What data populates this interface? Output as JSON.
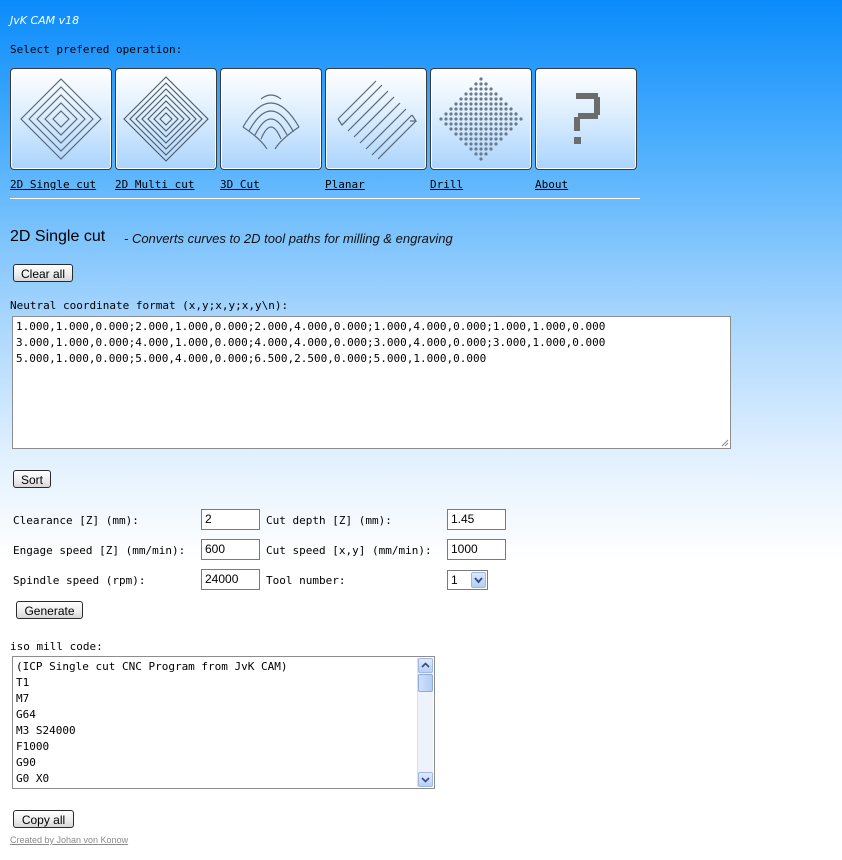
{
  "app": {
    "title": "JvK CAM v18"
  },
  "operation_prompt": "Select prefered operation:",
  "operations": [
    {
      "label": "2D Single cut",
      "icon": "2d-single-cut-icon"
    },
    {
      "label": "2D Multi cut",
      "icon": "2d-multi-cut-icon"
    },
    {
      "label": "3D Cut",
      "icon": "3d-cut-icon"
    },
    {
      "label": "Planar",
      "icon": "planar-icon"
    },
    {
      "label": "Drill",
      "icon": "drill-icon"
    },
    {
      "label": "About",
      "icon": "about-icon"
    }
  ],
  "section": {
    "title": "2D Single cut",
    "subtitle": "- Converts curves to 2D tool paths for milling & engraving"
  },
  "buttons": {
    "clear_all": "Clear all",
    "sort": "Sort",
    "generate": "Generate",
    "copy_all": "Copy all"
  },
  "coords": {
    "label": "Neutral coordinate format (x,y;x,y;x,y\\n):",
    "lines": [
      "1.000,1.000,0.000;2.000,1.000,0.000;2.000,4.000,0.000;1.000,4.000,0.000;1.000,1.000,0.000",
      "3.000,1.000,0.000;4.000,1.000,0.000;4.000,4.000,0.000;3.000,4.000,0.000;3.000,1.000,0.000",
      "5.000,1.000,0.000;5.000,4.000,0.000;6.500,2.500,0.000;5.000,1.000,0.000"
    ]
  },
  "params": {
    "clearance_label": "Clearance [Z] (mm):",
    "clearance_value": "2",
    "cut_depth_label": "Cut depth [Z] (mm):",
    "cut_depth_value": "1.45",
    "engage_label": "Engage speed [Z] (mm/min):",
    "engage_value": "600",
    "cut_speed_label": "Cut speed [x,y] (mm/min):",
    "cut_speed_value": "1000",
    "spindle_label": "Spindle speed (rpm):",
    "spindle_value": "24000",
    "tool_label": "Tool number:",
    "tool_value": "1"
  },
  "iso": {
    "label": "iso mill code:",
    "lines": [
      "(ICP Single cut CNC Program from JvK CAM)",
      "T1",
      "M7",
      "G64",
      "M3 S24000",
      "F1000",
      "G90",
      "G0 X0"
    ]
  },
  "footer": "Created by Johan von Konow",
  "colors": {
    "background_top": "#0a8bfb",
    "background_bottom": "#ffffff"
  }
}
